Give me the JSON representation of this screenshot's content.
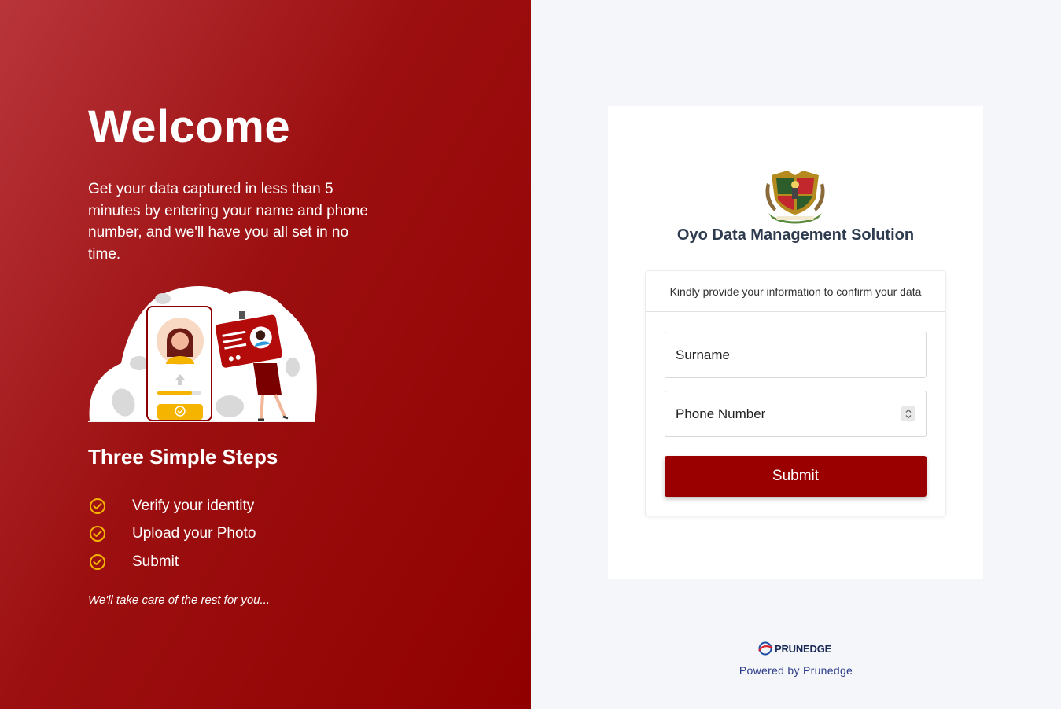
{
  "left": {
    "welcome": "Welcome",
    "intro": "Get your data captured in less than 5 minutes by entering your name and phone number, and we'll have you all set in no time.",
    "illustration_icon": "verification-illustration",
    "steps_title": "Three Simple Steps",
    "steps": [
      {
        "label": "Verify your identity",
        "icon": "check-circle-icon"
      },
      {
        "label": "Upload your Photo",
        "icon": "check-circle-icon"
      },
      {
        "label": "Submit",
        "icon": "check-circle-icon"
      }
    ],
    "tagline": "We'll take care of the rest for you..."
  },
  "right": {
    "crest_icon": "oyo-state-crest",
    "app_title": "Oyo Data Management Solution",
    "form": {
      "header": "Kindly provide your information to confirm your data",
      "surname_placeholder": "Surname",
      "phone_placeholder": "Phone Number",
      "submit_label": "Submit"
    },
    "footer": {
      "logo_prefix": "PRUN",
      "logo_suffix": "EDGE",
      "powered_by": "Powered by Prunedge"
    }
  },
  "colors": {
    "brand_red": "#9b0000",
    "check_gold": "#f5b400",
    "footer_blue": "#2b3d8a"
  }
}
